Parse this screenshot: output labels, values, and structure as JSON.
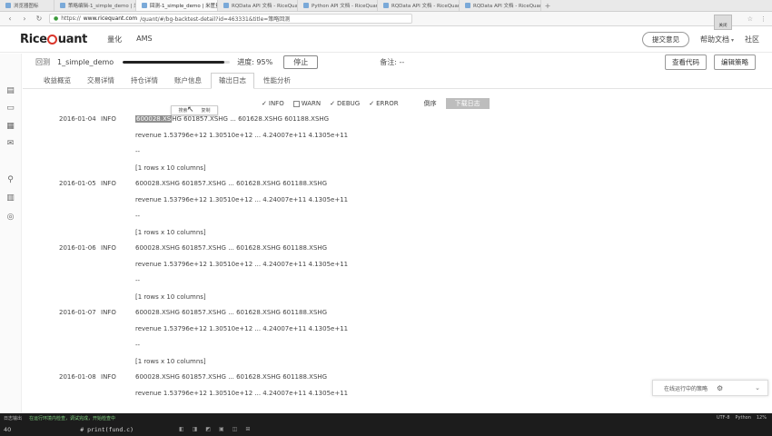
{
  "browser": {
    "tabs": [
      {
        "title": "浏览器图标",
        "active": false
      },
      {
        "title": "策略编辑-1_simple_demo | 米筐",
        "active": false
      },
      {
        "title": "回测-1_simple_demo | 米筐量化",
        "active": true
      },
      {
        "title": "RQData API 文档 - RiceQuant",
        "active": false
      },
      {
        "title": "Python API 文档 - RiceQuant",
        "active": false
      },
      {
        "title": "RQData API 文档 - RiceQuant",
        "active": false
      },
      {
        "title": "RQData API 文档 - RiceQuant",
        "active": false
      }
    ],
    "tab_close": "×",
    "new_tab": "+",
    "close_overlay": "关闭",
    "url_prefix": "https://",
    "url_host": "www.ricequant.com",
    "url_rest": "/quant/#/bg-backtest-detail?id=463331&title=策略回测",
    "nav_back": "‹",
    "nav_forward": "›",
    "nav_refresh": "↻",
    "addr_icons": [
      "☆",
      "⋮"
    ]
  },
  "app": {
    "logo_pre": "Rice",
    "logo_post": "uant",
    "nav": [
      "量化",
      "AMS"
    ],
    "feedback_btn": "提交意见",
    "help": "帮助文档",
    "community": "社区",
    "caret": "▾"
  },
  "progress": {
    "label": "回测",
    "name": "1_simple_demo",
    "percent": 95,
    "text": "进度: 95%",
    "stop": "停止",
    "remark": "备注: --",
    "view_code": "查看代码",
    "edit_strategy": "编辑策略"
  },
  "subtabs": [
    {
      "label": "收益概览",
      "active": false
    },
    {
      "label": "交易详情",
      "active": false
    },
    {
      "label": "持仓详情",
      "active": false
    },
    {
      "label": "账户信息",
      "active": false
    },
    {
      "label": "输出日志",
      "active": true
    },
    {
      "label": "性能分析",
      "active": false
    }
  ],
  "filters": {
    "items": [
      {
        "label": "INFO",
        "checked": true
      },
      {
        "label": "WARN",
        "checked": false
      },
      {
        "label": "DEBUG",
        "checked": true
      },
      {
        "label": "ERROR",
        "checked": true
      }
    ],
    "tick": "✓",
    "reverse": "倒序",
    "download": "下载日志"
  },
  "popup": {
    "copy": "搜索",
    "other": "复制"
  },
  "logs": [
    {
      "date": "2016-01-04",
      "level": "INFO",
      "line1_hl": "600028.XS",
      "line1": "HG 601857.XSHG ... 601628.XSHG 601188.XSHG",
      "revenue": "revenue 1.53796e+12 1.30510e+12 ... 4.24007e+11 4.1305e+11",
      "dots": "--",
      "rows": "[1 rows x 10 columns]"
    },
    {
      "date": "2016-01-05",
      "level": "INFO",
      "line1_hl": "",
      "line1": "600028.XSHG 601857.XSHG ... 601628.XSHG 601188.XSHG",
      "revenue": "revenue 1.53796e+12 1.30510e+12 ... 4.24007e+11 4.1305e+11",
      "dots": "--",
      "rows": "[1 rows x 10 columns]"
    },
    {
      "date": "2016-01-06",
      "level": "INFO",
      "line1_hl": "",
      "line1": "600028.XSHG 601857.XSHG ... 601628.XSHG 601188.XSHG",
      "revenue": "revenue 1.53796e+12 1.30510e+12 ... 4.24007e+11 4.1305e+11",
      "dots": "--",
      "rows": "[1 rows x 10 columns]"
    },
    {
      "date": "2016-01-07",
      "level": "INFO",
      "line1_hl": "",
      "line1": "600028.XSHG 601857.XSHG ... 601628.XSHG 601188.XSHG",
      "revenue": "revenue 1.53796e+12 1.30510e+12 ... 4.24007e+11 4.1305e+11",
      "dots": "--",
      "rows": "[1 rows x 10 columns]"
    },
    {
      "date": "2016-01-08",
      "level": "INFO",
      "line1_hl": "",
      "line1": "600028.XSHG 601857.XSHG ... 601628.XSHG 601188.XSHG",
      "revenue": "revenue 1.53796e+12 1.30510e+12 ... 4.24007e+11 4.1305e+11",
      "dots": "",
      "rows": ""
    }
  ],
  "float_widget": {
    "label": "在线运行中的策略",
    "gear": "⚙",
    "chevron": "⌄"
  },
  "taskbar": {
    "row1_left": "日志输出",
    "row1_mid": "在运行环境内检查，调试完成，开始检查中",
    "row1_right": [
      "UTF-8",
      "Python",
      "12%"
    ],
    "line_no": "40",
    "code": "#   print(fund.c)",
    "icons": [
      "◧",
      "◨",
      "◩",
      "▣",
      "◫",
      "⊞"
    ]
  },
  "colors": {
    "accent_red": "#d9362b",
    "highlight": "#8f8f8f",
    "download_btn": "#bdbdbd"
  }
}
